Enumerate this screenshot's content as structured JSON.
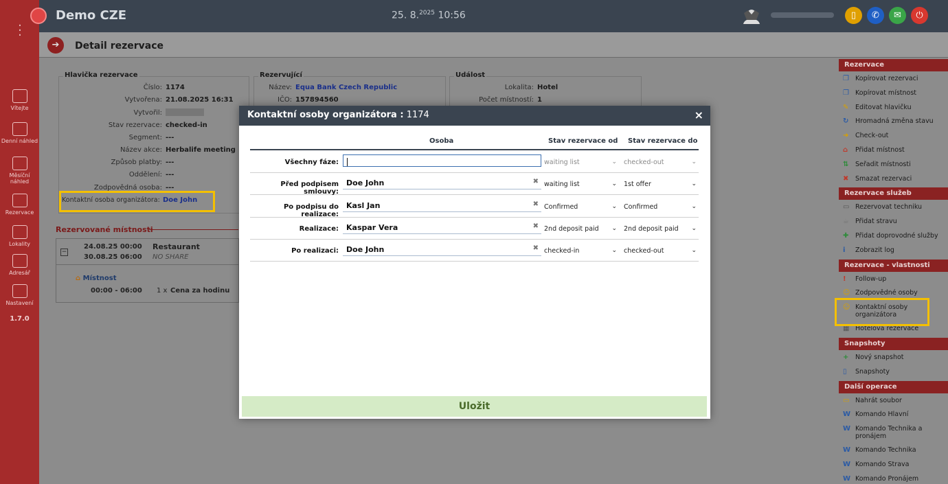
{
  "app": {
    "title": "Demo CZE",
    "date": "25. 8.",
    "year": "2025",
    "time": "10:56",
    "version": "1.7.0",
    "brand_color": "#a52b2b",
    "topbar_buttons": [
      {
        "icon": "book-icon",
        "color": "#e0a000"
      },
      {
        "icon": "phone-icon",
        "color": "#1f5fc4"
      },
      {
        "icon": "chat-icon",
        "color": "#3aa548"
      },
      {
        "icon": "power-icon",
        "color": "#d8382f"
      }
    ]
  },
  "nav": [
    {
      "label": "Vítejte",
      "icon": "home-icon"
    },
    {
      "label": "Denní náhled",
      "icon": "daily-view-icon"
    },
    {
      "label": "Měsíční náhled",
      "icon": "monthly-chart-icon"
    },
    {
      "label": "Rezervace",
      "icon": "bell-icon"
    },
    {
      "label": "Lokality",
      "icon": "location-icon"
    },
    {
      "label": "Adresář",
      "icon": "address-book-icon"
    },
    {
      "label": "Nastavení",
      "icon": "settings-icon"
    }
  ],
  "page": {
    "title": "Detail rezervace",
    "header_box": {
      "legend": "Hlavička rezervace",
      "rows": [
        {
          "label": "Číslo:",
          "value": "1174"
        },
        {
          "label": "Vytvořena:",
          "value": "21.08.2025 16:31"
        },
        {
          "label": "Vytvořil:",
          "value": ""
        },
        {
          "label": "Stav rezervace:",
          "value": "checked-in"
        },
        {
          "label": "Segment:",
          "value": "---"
        },
        {
          "label": "Název akce:",
          "value": "Herbalife meeting"
        },
        {
          "label": "Způsob platby:",
          "value": "---"
        },
        {
          "label": "Oddělení:",
          "value": "---"
        },
        {
          "label": "Zodpovědná osoba:",
          "value": "---"
        },
        {
          "label": "Kontaktní osoba organizátora:",
          "value": "Doe John"
        }
      ]
    },
    "client_box": {
      "legend": "Rezervující",
      "rows": [
        {
          "label": "Název:",
          "value": "Equa Bank Czech Republic"
        },
        {
          "label": "IČO:",
          "value": "157894560"
        }
      ]
    },
    "event_box": {
      "legend": "Událost",
      "rows": [
        {
          "label": "Lokalita:",
          "value": "Hotel"
        },
        {
          "label": "Počet místností:",
          "value": "1"
        }
      ]
    },
    "rooms": {
      "title": "Rezervované místnosti",
      "toggle": "−",
      "from": "24.08.25 00:00",
      "to": "30.08.25 06:00",
      "name": "Restaurant",
      "share": "NO SHARE",
      "room_label": "Místnost",
      "time": "00:00 - 06:00",
      "qty": "1 x",
      "price_label": "Cena za hodinu"
    }
  },
  "right_panel": {
    "sections": [
      {
        "title": "Rezervace",
        "items": [
          {
            "label": "Kopírovat rezervaci",
            "icon": "copy-icon",
            "color": "#2a5aa5"
          },
          {
            "label": "Kopírovat místnost",
            "icon": "copy-icon",
            "color": "#2a5aa5"
          },
          {
            "label": "Editovat hlavičku",
            "icon": "pencil-icon",
            "color": "#d8a000"
          },
          {
            "label": "Hromadná změna stavu",
            "icon": "refresh-icon",
            "color": "#2a5aa5"
          },
          {
            "label": "Check-out",
            "icon": "checkout-icon",
            "color": "#d8a000"
          },
          {
            "label": "Přidat místnost",
            "icon": "house-icon",
            "color": "#c0392b"
          },
          {
            "label": "Seřadit místnosti",
            "icon": "sort-icon",
            "color": "#2e8b3a"
          },
          {
            "label": "Smazat rezervaci",
            "icon": "delete-icon",
            "color": "#c0392b"
          }
        ]
      },
      {
        "title": "Rezervace služeb",
        "items": [
          {
            "label": "Rezervovat techniku",
            "icon": "monitor-icon",
            "color": "#555"
          },
          {
            "label": "Přidat stravu",
            "icon": "cup-icon",
            "color": "#777"
          },
          {
            "label": "Přidat doprovodné služby",
            "icon": "puzzle-icon",
            "color": "#2e8b3a"
          },
          {
            "label": "Zobrazit log",
            "icon": "info-icon",
            "color": "#2a5aa5"
          }
        ]
      },
      {
        "title": "Rezervace - vlastnosti",
        "items": [
          {
            "label": "Follow-up",
            "icon": "alert-icon",
            "color": "#c0392b"
          },
          {
            "label": "Zodpovědné osoby",
            "icon": "users-icon",
            "color": "#d8a000"
          },
          {
            "label": "Kontaktní osoby organizátora",
            "icon": "contact-icon",
            "color": "#d8a000"
          },
          {
            "label": "Hotelová rezervace",
            "icon": "hotel-icon",
            "color": "#555"
          }
        ]
      },
      {
        "title": "Snapshoty",
        "items": [
          {
            "label": "Nový snapshot",
            "icon": "plus-icon",
            "color": "#2e8b3a"
          },
          {
            "label": "Snapshoty",
            "icon": "book-icon",
            "color": "#2a5aa5"
          }
        ]
      },
      {
        "title": "Další operace",
        "items": [
          {
            "label": "Nahrát soubor",
            "icon": "folder-icon",
            "color": "#d8a000"
          },
          {
            "label": "Komando Hlavní",
            "icon": "word-doc-icon",
            "color": "#2a5aa5"
          },
          {
            "label": "Komando Technika a pronájem",
            "icon": "word-doc-icon",
            "color": "#2a5aa5"
          },
          {
            "label": "Komando Technika",
            "icon": "word-doc-icon",
            "color": "#2a5aa5"
          },
          {
            "label": "Komando Strava",
            "icon": "word-doc-icon",
            "color": "#2a5aa5"
          },
          {
            "label": "Komando Pronájem",
            "icon": "word-doc-icon",
            "color": "#2a5aa5"
          }
        ]
      }
    ]
  },
  "modal": {
    "title": "Kontaktní osoby organizátora :",
    "id": "1174",
    "close": "×",
    "col_person": "Osoba",
    "col_from": "Stav rezervace od",
    "col_to": "Stav rezervace do",
    "rows": [
      {
        "label": "Všechny fáze:",
        "person": "",
        "from": "waiting list",
        "to": "checked-out",
        "muted": true
      },
      {
        "label": "Před podpisem smlouvy:",
        "person": "Doe John",
        "from": "waiting list",
        "to": "1st offer",
        "muted": false
      },
      {
        "label": "Po podpisu do realizace:",
        "person": "Kasl Jan",
        "from": "Confirmed",
        "to": "Confirmed",
        "muted": false
      },
      {
        "label": "Realizace:",
        "person": "Kaspar Vera",
        "from": "2nd deposit paid",
        "to": "2nd deposit paid",
        "muted": false
      },
      {
        "label": "Po realizaci:",
        "person": "Doe John",
        "from": "checked-in",
        "to": "checked-out",
        "muted": false
      }
    ],
    "save": "Uložit"
  }
}
